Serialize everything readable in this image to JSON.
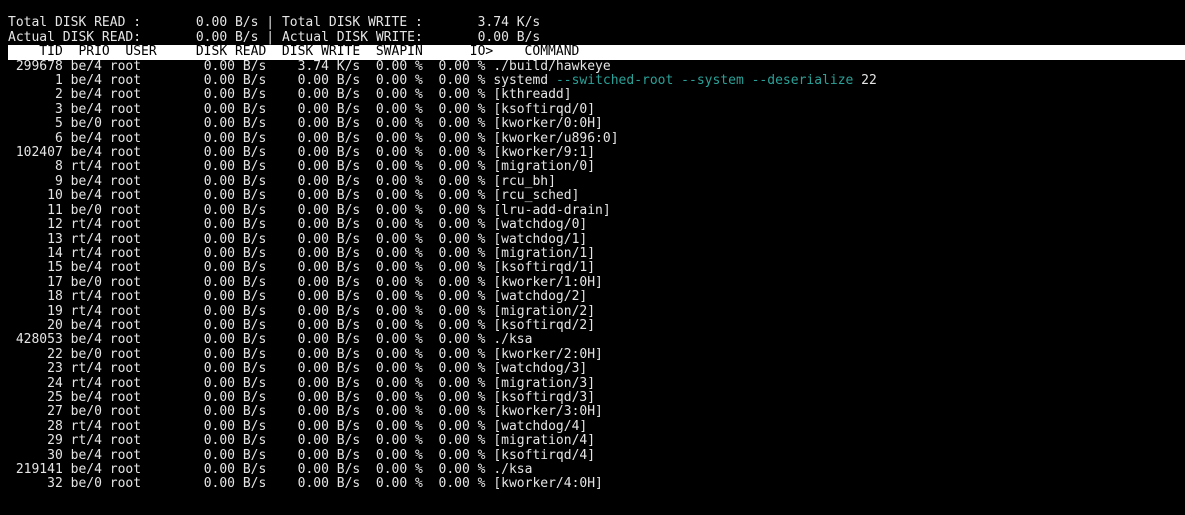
{
  "header": {
    "line1_left": "Total DISK READ :       0.00 B/s",
    "line1_right": "Total DISK WRITE :       3.74 K/s",
    "line2_left": "Actual DISK READ:       0.00 B/s",
    "line2_right": "Actual DISK WRITE:       0.00 B/s",
    "sep": " | ",
    "columns": "    TID  PRIO  USER     DISK READ  DISK WRITE  SWAPIN      IO>    COMMAND                                                                                                                          "
  },
  "rows": [
    {
      "tid": "299678",
      "prio": "be/4",
      "user": "root",
      "read": "0.00 B/s",
      "write": "3.74 K/s",
      "swapin": "0.00 %",
      "io": "0.00 %",
      "cmdBase": "./build/hawkeye",
      "cmdArgs": "",
      "argTail": ""
    },
    {
      "tid": "1",
      "prio": "be/4",
      "user": "root",
      "read": "0.00 B/s",
      "write": "0.00 B/s",
      "swapin": "0.00 %",
      "io": "0.00 %",
      "cmdBase": "systemd ",
      "cmdArgs": "--switched-root --system --deserialize",
      "argTail": " 22"
    },
    {
      "tid": "2",
      "prio": "be/4",
      "user": "root",
      "read": "0.00 B/s",
      "write": "0.00 B/s",
      "swapin": "0.00 %",
      "io": "0.00 %",
      "cmdBase": "[kthreadd]",
      "cmdArgs": "",
      "argTail": ""
    },
    {
      "tid": "3",
      "prio": "be/4",
      "user": "root",
      "read": "0.00 B/s",
      "write": "0.00 B/s",
      "swapin": "0.00 %",
      "io": "0.00 %",
      "cmdBase": "[ksoftirqd/0]",
      "cmdArgs": "",
      "argTail": ""
    },
    {
      "tid": "5",
      "prio": "be/0",
      "user": "root",
      "read": "0.00 B/s",
      "write": "0.00 B/s",
      "swapin": "0.00 %",
      "io": "0.00 %",
      "cmdBase": "[kworker/0:0H]",
      "cmdArgs": "",
      "argTail": ""
    },
    {
      "tid": "6",
      "prio": "be/4",
      "user": "root",
      "read": "0.00 B/s",
      "write": "0.00 B/s",
      "swapin": "0.00 %",
      "io": "0.00 %",
      "cmdBase": "[kworker/u896:0]",
      "cmdArgs": "",
      "argTail": ""
    },
    {
      "tid": "102407",
      "prio": "be/4",
      "user": "root",
      "read": "0.00 B/s",
      "write": "0.00 B/s",
      "swapin": "0.00 %",
      "io": "0.00 %",
      "cmdBase": "[kworker/9:1]",
      "cmdArgs": "",
      "argTail": ""
    },
    {
      "tid": "8",
      "prio": "rt/4",
      "user": "root",
      "read": "0.00 B/s",
      "write": "0.00 B/s",
      "swapin": "0.00 %",
      "io": "0.00 %",
      "cmdBase": "[migration/0]",
      "cmdArgs": "",
      "argTail": ""
    },
    {
      "tid": "9",
      "prio": "be/4",
      "user": "root",
      "read": "0.00 B/s",
      "write": "0.00 B/s",
      "swapin": "0.00 %",
      "io": "0.00 %",
      "cmdBase": "[rcu_bh]",
      "cmdArgs": "",
      "argTail": ""
    },
    {
      "tid": "10",
      "prio": "be/4",
      "user": "root",
      "read": "0.00 B/s",
      "write": "0.00 B/s",
      "swapin": "0.00 %",
      "io": "0.00 %",
      "cmdBase": "[rcu_sched]",
      "cmdArgs": "",
      "argTail": ""
    },
    {
      "tid": "11",
      "prio": "be/0",
      "user": "root",
      "read": "0.00 B/s",
      "write": "0.00 B/s",
      "swapin": "0.00 %",
      "io": "0.00 %",
      "cmdBase": "[lru-add-drain]",
      "cmdArgs": "",
      "argTail": ""
    },
    {
      "tid": "12",
      "prio": "rt/4",
      "user": "root",
      "read": "0.00 B/s",
      "write": "0.00 B/s",
      "swapin": "0.00 %",
      "io": "0.00 %",
      "cmdBase": "[watchdog/0]",
      "cmdArgs": "",
      "argTail": ""
    },
    {
      "tid": "13",
      "prio": "rt/4",
      "user": "root",
      "read": "0.00 B/s",
      "write": "0.00 B/s",
      "swapin": "0.00 %",
      "io": "0.00 %",
      "cmdBase": "[watchdog/1]",
      "cmdArgs": "",
      "argTail": ""
    },
    {
      "tid": "14",
      "prio": "rt/4",
      "user": "root",
      "read": "0.00 B/s",
      "write": "0.00 B/s",
      "swapin": "0.00 %",
      "io": "0.00 %",
      "cmdBase": "[migration/1]",
      "cmdArgs": "",
      "argTail": ""
    },
    {
      "tid": "15",
      "prio": "be/4",
      "user": "root",
      "read": "0.00 B/s",
      "write": "0.00 B/s",
      "swapin": "0.00 %",
      "io": "0.00 %",
      "cmdBase": "[ksoftirqd/1]",
      "cmdArgs": "",
      "argTail": ""
    },
    {
      "tid": "17",
      "prio": "be/0",
      "user": "root",
      "read": "0.00 B/s",
      "write": "0.00 B/s",
      "swapin": "0.00 %",
      "io": "0.00 %",
      "cmdBase": "[kworker/1:0H]",
      "cmdArgs": "",
      "argTail": ""
    },
    {
      "tid": "18",
      "prio": "rt/4",
      "user": "root",
      "read": "0.00 B/s",
      "write": "0.00 B/s",
      "swapin": "0.00 %",
      "io": "0.00 %",
      "cmdBase": "[watchdog/2]",
      "cmdArgs": "",
      "argTail": ""
    },
    {
      "tid": "19",
      "prio": "rt/4",
      "user": "root",
      "read": "0.00 B/s",
      "write": "0.00 B/s",
      "swapin": "0.00 %",
      "io": "0.00 %",
      "cmdBase": "[migration/2]",
      "cmdArgs": "",
      "argTail": ""
    },
    {
      "tid": "20",
      "prio": "be/4",
      "user": "root",
      "read": "0.00 B/s",
      "write": "0.00 B/s",
      "swapin": "0.00 %",
      "io": "0.00 %",
      "cmdBase": "[ksoftirqd/2]",
      "cmdArgs": "",
      "argTail": ""
    },
    {
      "tid": "428053",
      "prio": "be/4",
      "user": "root",
      "read": "0.00 B/s",
      "write": "0.00 B/s",
      "swapin": "0.00 %",
      "io": "0.00 %",
      "cmdBase": "./ksa",
      "cmdArgs": "",
      "argTail": ""
    },
    {
      "tid": "22",
      "prio": "be/0",
      "user": "root",
      "read": "0.00 B/s",
      "write": "0.00 B/s",
      "swapin": "0.00 %",
      "io": "0.00 %",
      "cmdBase": "[kworker/2:0H]",
      "cmdArgs": "",
      "argTail": ""
    },
    {
      "tid": "23",
      "prio": "rt/4",
      "user": "root",
      "read": "0.00 B/s",
      "write": "0.00 B/s",
      "swapin": "0.00 %",
      "io": "0.00 %",
      "cmdBase": "[watchdog/3]",
      "cmdArgs": "",
      "argTail": ""
    },
    {
      "tid": "24",
      "prio": "rt/4",
      "user": "root",
      "read": "0.00 B/s",
      "write": "0.00 B/s",
      "swapin": "0.00 %",
      "io": "0.00 %",
      "cmdBase": "[migration/3]",
      "cmdArgs": "",
      "argTail": ""
    },
    {
      "tid": "25",
      "prio": "be/4",
      "user": "root",
      "read": "0.00 B/s",
      "write": "0.00 B/s",
      "swapin": "0.00 %",
      "io": "0.00 %",
      "cmdBase": "[ksoftirqd/3]",
      "cmdArgs": "",
      "argTail": ""
    },
    {
      "tid": "27",
      "prio": "be/0",
      "user": "root",
      "read": "0.00 B/s",
      "write": "0.00 B/s",
      "swapin": "0.00 %",
      "io": "0.00 %",
      "cmdBase": "[kworker/3:0H]",
      "cmdArgs": "",
      "argTail": ""
    },
    {
      "tid": "28",
      "prio": "rt/4",
      "user": "root",
      "read": "0.00 B/s",
      "write": "0.00 B/s",
      "swapin": "0.00 %",
      "io": "0.00 %",
      "cmdBase": "[watchdog/4]",
      "cmdArgs": "",
      "argTail": ""
    },
    {
      "tid": "29",
      "prio": "rt/4",
      "user": "root",
      "read": "0.00 B/s",
      "write": "0.00 B/s",
      "swapin": "0.00 %",
      "io": "0.00 %",
      "cmdBase": "[migration/4]",
      "cmdArgs": "",
      "argTail": ""
    },
    {
      "tid": "30",
      "prio": "be/4",
      "user": "root",
      "read": "0.00 B/s",
      "write": "0.00 B/s",
      "swapin": "0.00 %",
      "io": "0.00 %",
      "cmdBase": "[ksoftirqd/4]",
      "cmdArgs": "",
      "argTail": ""
    },
    {
      "tid": "219141",
      "prio": "be/4",
      "user": "root",
      "read": "0.00 B/s",
      "write": "0.00 B/s",
      "swapin": "0.00 %",
      "io": "0.00 %",
      "cmdBase": "./ksa",
      "cmdArgs": "",
      "argTail": ""
    },
    {
      "tid": "32",
      "prio": "be/0",
      "user": "root",
      "read": "0.00 B/s",
      "write": "0.00 B/s",
      "swapin": "0.00 %",
      "io": "0.00 %",
      "cmdBase": "[kworker/4:0H]",
      "cmdArgs": "",
      "argTail": ""
    }
  ]
}
